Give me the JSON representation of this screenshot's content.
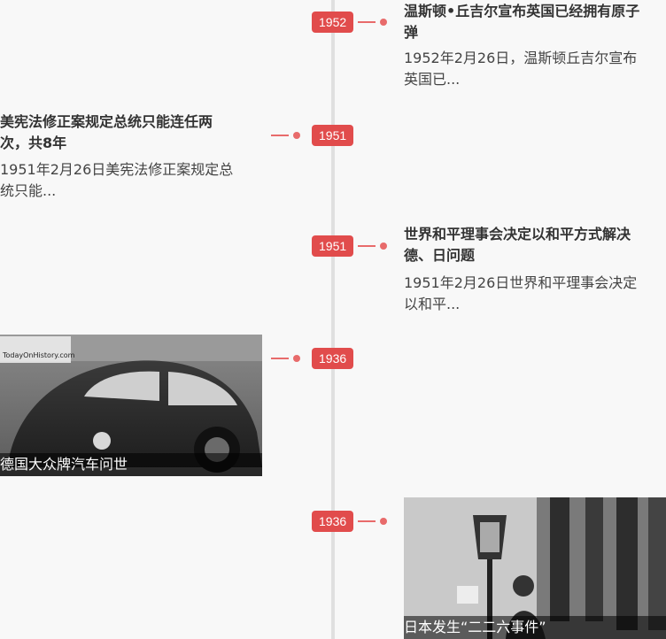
{
  "timeline": [
    {
      "year": "1952",
      "title": "温斯顿•丘吉尔宣布英国已经拥有原子弹",
      "title_line1": "温斯顿•丘吉尔宣布英国已经拥有原子",
      "title_line2": "弹",
      "desc_line1": "1952年2月26日，温斯顿丘吉尔宣布",
      "desc_line2": "英国已..."
    },
    {
      "year": "1951",
      "title_line1": "美宪法修正案规定总统只能连任两",
      "title_line2": "次，共8年",
      "desc_line1": "1951年2月26日美宪法修正案规定总",
      "desc_line2": "统只能..."
    },
    {
      "year": "1951",
      "title_line1": "世界和平理事会决定以和平方式解决",
      "title_line2": "德、日问题",
      "desc_line1": "1951年2月26日世界和平理事会决定",
      "desc_line2": "以和平..."
    },
    {
      "year": "1936",
      "caption": "德国大众牌汽车问世",
      "watermark": "TodayOnHistory.com"
    },
    {
      "year": "1936",
      "caption": "日本发生“二二六事件”"
    }
  ],
  "colors": {
    "accent": "#e14c4c",
    "connector": "#e86b6b",
    "axis": "#e0e0e0",
    "background": "#f8f8f8"
  }
}
